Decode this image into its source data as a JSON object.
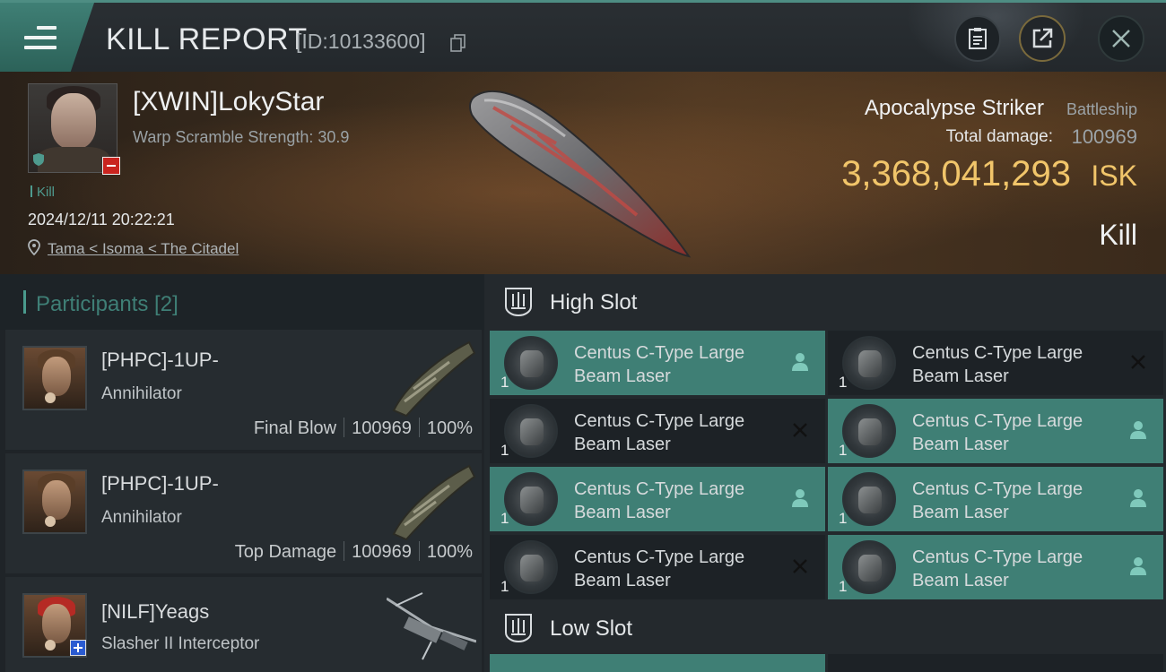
{
  "header": {
    "title": "KILL REPORT",
    "report_id": "[ID:10133600]",
    "icons": [
      "menu-icon",
      "copy-icon",
      "clipboard-icon",
      "share-icon",
      "close-icon"
    ]
  },
  "victim": {
    "name": "[XWIN]LokyStar",
    "warp_scramble": "Warp Scramble Strength: 30.9",
    "tag": "Kill",
    "datetime": "2024/12/11 20:22:21",
    "location": "Tama < Isoma < The Citadel"
  },
  "ship": {
    "name": "Apocalypse Striker",
    "class": "Battleship",
    "total_damage_label": "Total damage:",
    "total_damage": "100969",
    "isk_value": "3,368,041,293",
    "isk_unit": "ISK",
    "result": "Kill"
  },
  "participants": {
    "title": "Participants [2]",
    "items": [
      {
        "name": "[PHPC]-1UP-",
        "ship": "Annihilator",
        "role": "Final Blow",
        "damage": "100969",
        "percent": "100%"
      },
      {
        "name": "[PHPC]-1UP-",
        "ship": "Annihilator",
        "role": "Top Damage",
        "damage": "100969",
        "percent": "100%"
      },
      {
        "name": "[NILF]Yeags",
        "ship": "Slasher II Interceptor"
      }
    ]
  },
  "fittings": {
    "high_slot_title": "High Slot",
    "low_slot_title": "Low Slot",
    "high_slot": [
      {
        "name": "Centus C-Type Large Beam Laser",
        "qty": "1",
        "state": "fitted"
      },
      {
        "name": "Centus C-Type Large Beam Laser",
        "qty": "1",
        "state": "destroyed"
      },
      {
        "name": "Centus C-Type Large Beam Laser",
        "qty": "1",
        "state": "destroyed"
      },
      {
        "name": "Centus C-Type Large Beam Laser",
        "qty": "1",
        "state": "fitted"
      },
      {
        "name": "Centus C-Type Large Beam Laser",
        "qty": "1",
        "state": "fitted"
      },
      {
        "name": "Centus C-Type Large Beam Laser",
        "qty": "1",
        "state": "fitted"
      },
      {
        "name": "Centus C-Type Large Beam Laser",
        "qty": "1",
        "state": "destroyed"
      },
      {
        "name": "Centus C-Type Large Beam Laser",
        "qty": "1",
        "state": "fitted"
      }
    ]
  },
  "colors": {
    "accent": "#3f7f75",
    "isk": "#f1c56a",
    "badge_red": "#c9241f",
    "badge_blue": "#2a5bd1"
  }
}
